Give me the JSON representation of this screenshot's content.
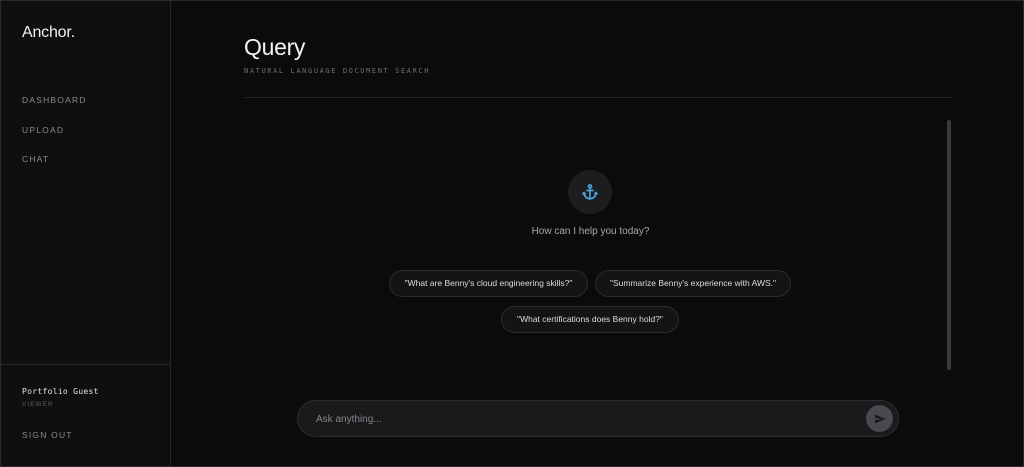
{
  "brand": "Anchor.",
  "nav": {
    "items": [
      {
        "label": "DASHBOARD"
      },
      {
        "label": "UPLOAD"
      },
      {
        "label": "CHAT"
      }
    ]
  },
  "user": {
    "name": "Portfolio Guest",
    "role": "VIEWER",
    "sign_out_label": "SIGN OUT"
  },
  "header": {
    "title": "Query",
    "subtitle": "NATURAL LANGUAGE DOCUMENT SEARCH"
  },
  "chat": {
    "icon": "anchor-icon",
    "greeting": "How can I help you today?",
    "suggestions": [
      "\"What are Benny's cloud engineering skills?\"",
      "\"Summarize Benny's experience with AWS.\"",
      "\"What certifications does Benny hold?\""
    ]
  },
  "input": {
    "placeholder": "Ask anything...",
    "value": "",
    "send_icon": "send-icon"
  },
  "colors": {
    "background": "#0b0b0c",
    "sidebar": "#0f0f10",
    "accent": "#4aa3df"
  }
}
